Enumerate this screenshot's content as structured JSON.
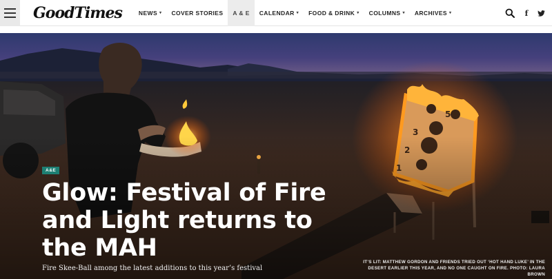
{
  "site": {
    "logo_text": "GoodTimes"
  },
  "nav": {
    "items": [
      {
        "label": "NEWS",
        "has_dropdown": true,
        "active": false
      },
      {
        "label": "COVER STORIES",
        "has_dropdown": false,
        "active": false
      },
      {
        "label": "A & E",
        "has_dropdown": true,
        "active": true
      },
      {
        "label": "CALENDAR",
        "has_dropdown": true,
        "active": false
      },
      {
        "label": "FOOD & DRINK",
        "has_dropdown": true,
        "active": false
      },
      {
        "label": "COLUMNS",
        "has_dropdown": true,
        "active": false
      },
      {
        "label": "ARCHIVES",
        "has_dropdown": true,
        "active": false
      }
    ],
    "caret": "▾"
  },
  "header_icons": {
    "menu": "hamburger-menu-icon",
    "search": "search-icon",
    "facebook": "facebook-icon",
    "facebook_glyph": "f",
    "twitter": "twitter-icon"
  },
  "hero": {
    "category_badge": "A&E",
    "headline": "Glow: Festival of Fire and Light returns to the MAH",
    "dek": "Fire Skee-Ball among the latest additions to this year’s festival",
    "caption": "IT’S LIT: MATTHEW GORDON AND FRIENDS TRIED OUT ‘HOT HAND LUKE’ IN THE DESERT EARLIER THIS YEAR, AND NO ONE CAUGHT ON FIRE. PHOTO: LAURA BROWN",
    "board_numbers": [
      "5",
      "3",
      "2",
      "1"
    ]
  },
  "colors": {
    "badge": "#1d7f73",
    "header_bg": "#ffffff",
    "active_nav_bg": "#ececec",
    "flame": "#ff9a1f"
  }
}
